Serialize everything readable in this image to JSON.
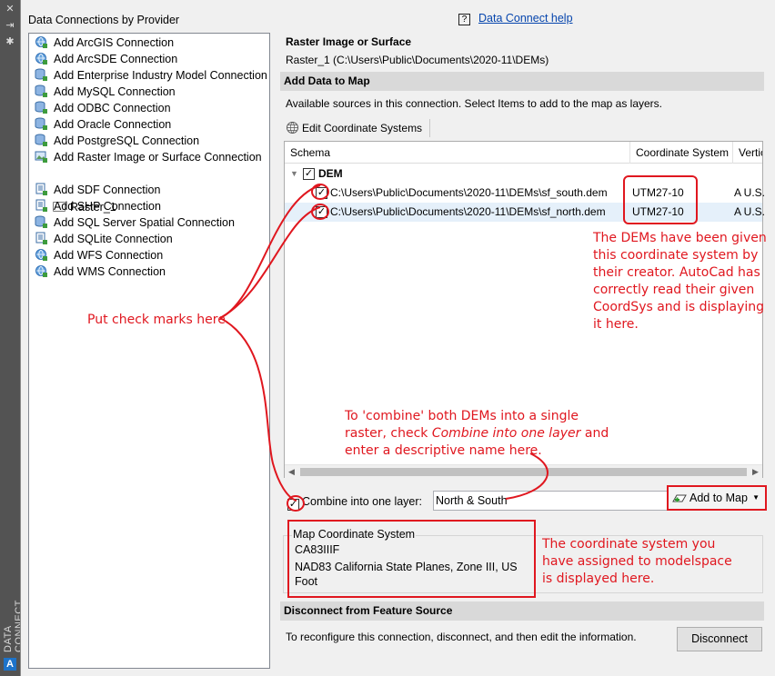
{
  "side": {
    "vertical_title": "DATA CONNECT"
  },
  "providers_panel": {
    "title": "Data Connections by Provider",
    "items": [
      {
        "label": "Add ArcGIS Connection",
        "icon": "globe-connection-icon"
      },
      {
        "label": "Add ArcSDE Connection",
        "icon": "globe-connection-icon"
      },
      {
        "label": "Add Enterprise Industry Model Connection",
        "icon": "database-connection-icon"
      },
      {
        "label": "Add MySQL Connection",
        "icon": "database-connection-icon"
      },
      {
        "label": "Add ODBC Connection",
        "icon": "database-connection-icon"
      },
      {
        "label": "Add Oracle Connection",
        "icon": "database-connection-icon"
      },
      {
        "label": "Add PostgreSQL Connection",
        "icon": "database-connection-icon"
      },
      {
        "label": "Add Raster Image or Surface Connection",
        "icon": "raster-connection-icon"
      },
      {
        "label": "Add SDF Connection",
        "icon": "file-connection-icon"
      },
      {
        "label": "Add SHP Connection",
        "icon": "file-connection-icon"
      },
      {
        "label": "Add SQL Server Spatial Connection",
        "icon": "database-connection-icon"
      },
      {
        "label": "Add SQLite Connection",
        "icon": "file-connection-icon"
      },
      {
        "label": "Add WFS Connection",
        "icon": "globe-connection-icon"
      },
      {
        "label": "Add WMS Connection",
        "icon": "globe-connection-icon"
      }
    ],
    "sub_item": "Raster_1"
  },
  "help": {
    "icon": "?",
    "link": "Data Connect help"
  },
  "connection": {
    "type_title": "Raster Image or Surface",
    "source_line": "Raster_1 (C:\\Users\\Public\\Documents\\2020-11\\DEMs)"
  },
  "add_data": {
    "section_title": "Add Data to Map",
    "instructions": "Available sources in this connection.  Select Items to add to the map as layers.",
    "edit_cs_button": "Edit Coordinate Systems",
    "columns": [
      "Schema",
      "Coordinate System",
      "Vertic"
    ],
    "schema_name": "DEM",
    "rows": [
      {
        "checked": true,
        "path": "C:\\Users\\Public\\Documents\\2020-11\\DEMs\\sf_south.dem",
        "coord_sys": "UTM27-10",
        "vertical": "A U.S."
      },
      {
        "checked": true,
        "path": "C:\\Users\\Public\\Documents\\2020-11\\DEMs\\sf_north.dem",
        "coord_sys": "UTM27-10",
        "vertical": "A U.S."
      }
    ],
    "combine_label": "Combine into one layer:",
    "combine_value": "North & South",
    "add_to_map": "Add to Map"
  },
  "map_cs": {
    "group_title": "Map Coordinate System",
    "code": "CA83IIIF",
    "description": "NAD83 California State Planes, Zone III, US Foot"
  },
  "disconnect": {
    "section_title": "Disconnect from Feature Source",
    "text": "To reconfigure this connection, disconnect, and then edit the information.",
    "button": "Disconnect"
  },
  "annotations": {
    "checks": "Put check marks here.",
    "coordsys_1": "The DEMs have been given",
    "coordsys_2": "this coordinate system by",
    "coordsys_3": "their creator. AutoCad has",
    "coordsys_4": "correctly read their given",
    "coordsys_5": "CoordSys and is displaying",
    "coordsys_6": "it here.",
    "combine_1": "To 'combine' both DEMs into a single",
    "combine_2a": "raster, check ",
    "combine_2b": "Combine into one layer",
    "combine_2c": " and",
    "combine_3": "enter a descriptive name here.",
    "mapcs_1": "The coordinate system you",
    "mapcs_2": "have assigned to modelspace",
    "mapcs_3": "is displayed here."
  },
  "colors": {
    "annotation": "#e0171f",
    "link": "#0645ad",
    "section_bar": "#d9d9d9",
    "selected_row": "#e5f0fa"
  }
}
